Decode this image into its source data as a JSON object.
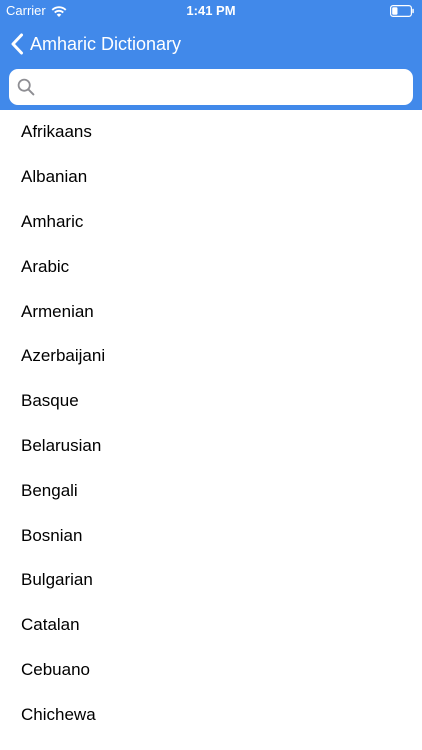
{
  "status_bar": {
    "carrier": "Carrier",
    "time": "1:41 PM",
    "battery_level": 0.3
  },
  "nav_bar": {
    "back_label": "Amharic Dictionary"
  },
  "search": {
    "placeholder": "",
    "value": ""
  },
  "colors": {
    "header_background": "#4189ea",
    "header_text": "#ffffff",
    "list_text": "#000000",
    "search_background": "#ffffff",
    "search_icon": "#8e8e93"
  },
  "icons": {
    "back": "chevron-left-icon",
    "wifi": "wifi-icon",
    "battery": "battery-icon",
    "search": "magnifying-glass-icon"
  },
  "languages": [
    "Afrikaans",
    "Albanian",
    "Amharic",
    "Arabic",
    "Armenian",
    "Azerbaijani",
    "Basque",
    "Belarusian",
    "Bengali",
    "Bosnian",
    "Bulgarian",
    "Catalan",
    "Cebuano",
    "Chichewa"
  ]
}
